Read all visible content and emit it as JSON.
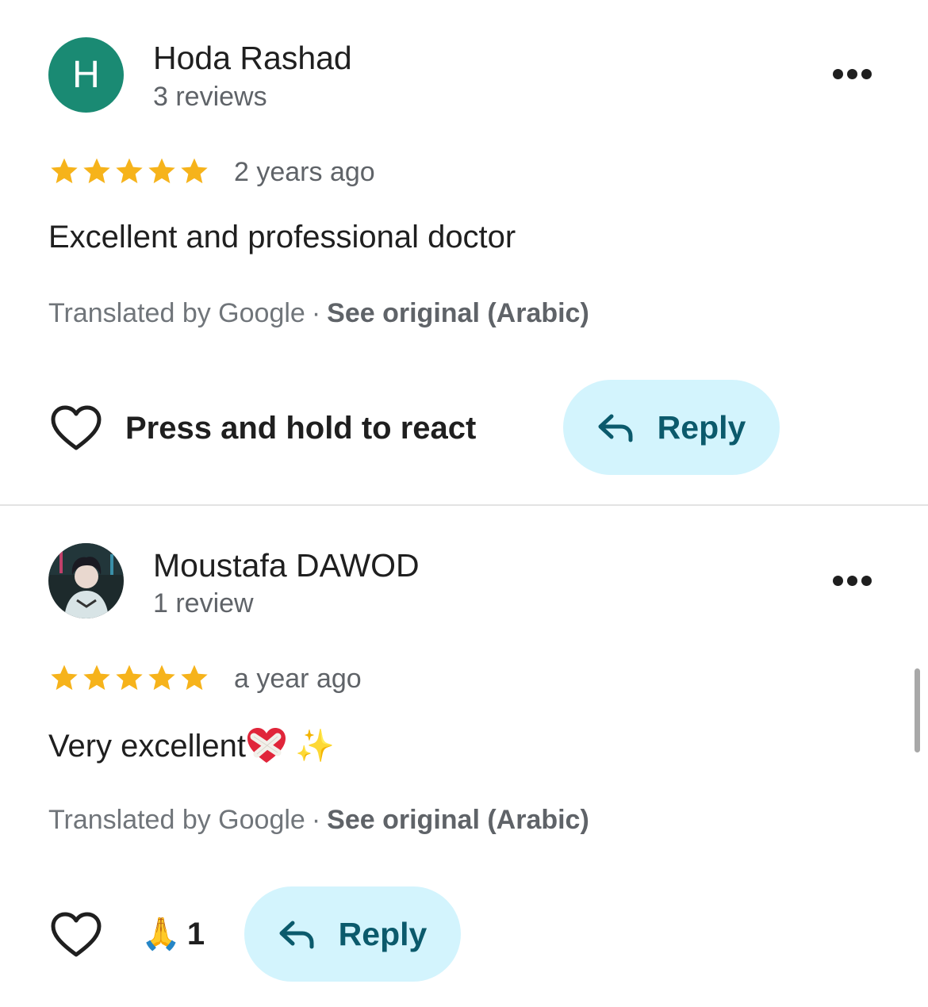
{
  "reviews": [
    {
      "avatar_letter": "H",
      "avatar_color": "#1a8a73",
      "author": "Hoda Rashad",
      "review_count": "3 reviews",
      "rating": 5,
      "date": "2 years ago",
      "text": "Excellent and professional doctor",
      "text_emoji": "",
      "translated_by": "Translated by Google",
      "separator": "·",
      "see_original": "See original (Arabic)",
      "react_hint": "Press and hold to react",
      "reply_label": "Reply"
    },
    {
      "avatar_letter": "",
      "author": "Moustafa DAWOD",
      "review_count": "1 review",
      "rating": 5,
      "date": "a year ago",
      "text": "Very excellent",
      "text_emoji": "✨",
      "translated_by": "Translated by Google",
      "separator": "·",
      "see_original": "See original (Arabic)",
      "reaction_emoji": "🙏",
      "reaction_count": "1",
      "reply_label": "Reply"
    }
  ],
  "colors": {
    "star": "#f6b31b",
    "reply_bg": "#d3f4fd",
    "reply_text": "#0b5a6c",
    "avatar_teal": "#1a8a73"
  },
  "icons": [
    "more-options-icon",
    "star-icon",
    "heart-outline-icon",
    "reply-arrow-icon",
    "mending-heart-emoji",
    "sparkles-emoji",
    "folded-hands-emoji"
  ]
}
